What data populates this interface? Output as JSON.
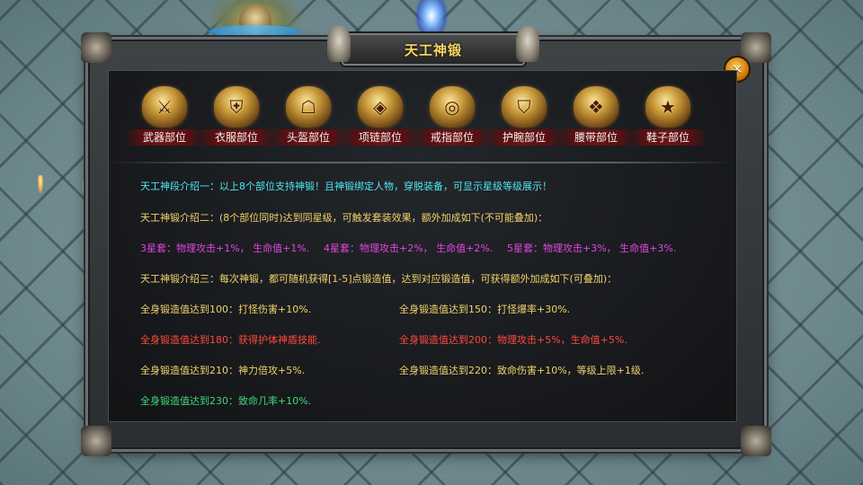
{
  "window": {
    "title": "天工神锻",
    "close_glyph": "✕"
  },
  "slots": [
    {
      "label": "武器部位",
      "icon": "weapon-crest-icon",
      "glyph": "⚔"
    },
    {
      "label": "衣服部位",
      "icon": "armor-crest-icon",
      "glyph": "⛨"
    },
    {
      "label": "头盔部位",
      "icon": "helmet-crest-icon",
      "glyph": "☖"
    },
    {
      "label": "项链部位",
      "icon": "necklace-crest-icon",
      "glyph": "◈"
    },
    {
      "label": "戒指部位",
      "icon": "ring-crest-icon",
      "glyph": "◎"
    },
    {
      "label": "护腕部位",
      "icon": "bracer-crest-icon",
      "glyph": "⛉"
    },
    {
      "label": "腰带部位",
      "icon": "belt-crest-icon",
      "glyph": "❖"
    },
    {
      "label": "鞋子部位",
      "icon": "boots-crest-icon",
      "glyph": "★"
    }
  ],
  "intro": {
    "line1": "天工神段介绍一：以上8个部位支持神锻！且神锻绑定人物，穿脱装备，可显示星级等级展示！",
    "line2": "天工神锻介绍二：(8个部位同时)达到同星级，可触发套装效果，额外加成如下(不可能叠加)：",
    "set3": "3星套：物理攻击+1%， 生命值+1%.",
    "set4": "4星套：物理攻击+2%， 生命值+2%.",
    "set5": "5星套：物理攻击+3%， 生命值+3%.",
    "line3": "天工神锻介绍三：每次神锻，都可随机获得[1-5]点锻造值，达到对应锻造值，可获得额外加成如下(可叠加)："
  },
  "bonuses": {
    "b100": "全身锻造值达到100：打怪伤害+10%.",
    "b150": "全身锻造值达到150：打怪爆率+30%.",
    "b180": "全身锻造值达到180：获得护体神盾技能.",
    "b200": "全身锻造值达到200：物理攻击+5%，生命值+5%.",
    "b210": "全身锻造值达到210：神力倍攻+5%.",
    "b220": "全身锻造值达到220：致命伤害+10%，等级上限+1级.",
    "b230": "全身锻造值达到230：致命几率+10%."
  },
  "colors": {
    "title": "#f5d76a",
    "cyan": "#4fe6f2",
    "yellow": "#f1d36a",
    "magenta": "#e246e0",
    "red": "#ff4a3a",
    "green": "#3fd87a"
  }
}
